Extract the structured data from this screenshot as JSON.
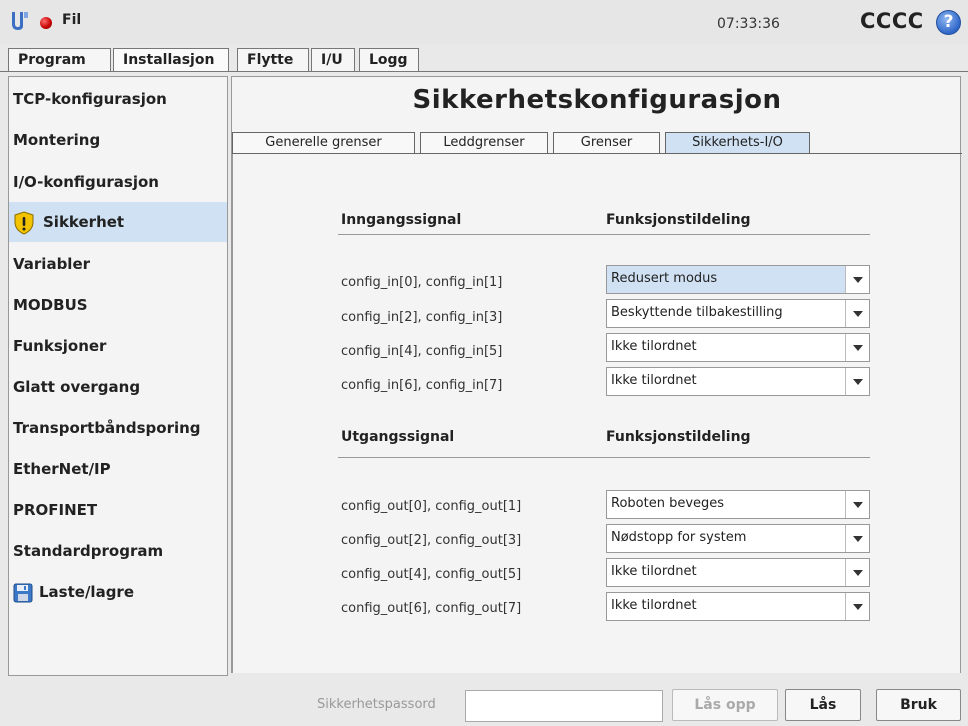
{
  "topbar": {
    "menu_label": "Fil",
    "clock": "07:33:36",
    "robot_name": "CCCC",
    "help_label": "?"
  },
  "main_tabs": [
    {
      "label": "Program",
      "active": false
    },
    {
      "label": "Installasjon",
      "active": true
    },
    {
      "label": "Flytte",
      "active": false
    },
    {
      "label": "I/U",
      "active": false
    },
    {
      "label": "Logg",
      "active": false
    }
  ],
  "sidebar": {
    "items": [
      {
        "label": "TCP-konfigurasjon"
      },
      {
        "label": "Montering"
      },
      {
        "label": "I/O-konfigurasjon"
      },
      {
        "label": "Sikkerhet",
        "icon": "warning-shield-icon",
        "active": true
      },
      {
        "label": "Variabler"
      },
      {
        "label": "MODBUS"
      },
      {
        "label": "Funksjoner"
      },
      {
        "label": "Glatt overgang"
      },
      {
        "label": "Transportbåndsporing"
      },
      {
        "label": "EtherNet/IP"
      },
      {
        "label": "PROFINET"
      },
      {
        "label": "Standardprogram"
      },
      {
        "label": "Laste/lagre",
        "icon": "floppy-disk-icon"
      }
    ]
  },
  "content": {
    "title": "Sikkerhetskonfigurasjon",
    "subtabs": [
      {
        "label": "Generelle grenser",
        "active": false
      },
      {
        "label": "Leddgrenser",
        "active": false
      },
      {
        "label": "Grenser",
        "active": false
      },
      {
        "label": "Sikkerhets-I/O",
        "active": true
      }
    ],
    "inputs": {
      "signal_header": "Inngangssignal",
      "function_header": "Funksjonstildeling",
      "rows": [
        {
          "signal": "config_in[0], config_in[1]",
          "value": "Redusert modus"
        },
        {
          "signal": "config_in[2], config_in[3]",
          "value": "Beskyttende tilbakestilling"
        },
        {
          "signal": "config_in[4], config_in[5]",
          "value": "Ikke tilordnet"
        },
        {
          "signal": "config_in[6], config_in[7]",
          "value": "Ikke tilordnet"
        }
      ]
    },
    "outputs": {
      "signal_header": "Utgangssignal",
      "function_header": "Funksjonstildeling",
      "rows": [
        {
          "signal": "config_out[0], config_out[1]",
          "value": "Roboten beveges"
        },
        {
          "signal": "config_out[2], config_out[3]",
          "value": "Nødstopp for system"
        },
        {
          "signal": "config_out[4], config_out[5]",
          "value": "Ikke tilordnet"
        },
        {
          "signal": "config_out[6], config_out[7]",
          "value": "Ikke tilordnet"
        }
      ]
    }
  },
  "bottom": {
    "password_label": "Sikkerhetspassord",
    "password_value": "",
    "unlock_label": "Lås opp",
    "lock_label": "Lås",
    "apply_label": "Bruk"
  },
  "colors": {
    "selection": "#cfe1f3",
    "run_indicator": "#c40000",
    "help_button": "#2f67c9"
  }
}
